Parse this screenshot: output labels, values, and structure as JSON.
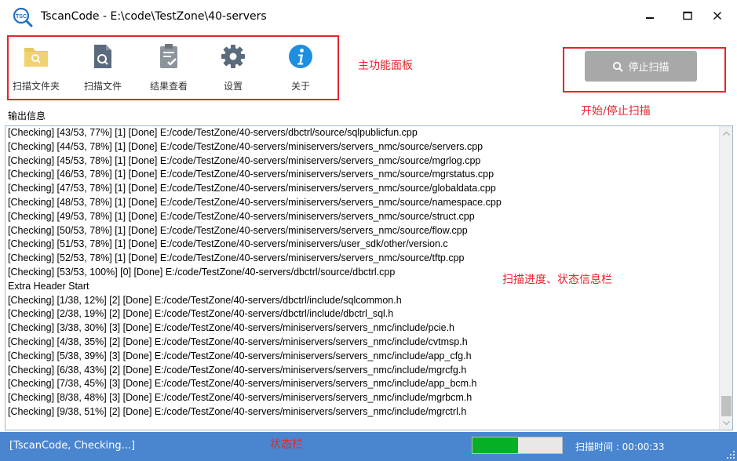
{
  "window": {
    "title": "TscanCode  -  E:\\code\\TestZone\\40-servers",
    "app_icon": "tsc-search-logo-icon",
    "controls": {
      "minimize": "minimize-icon",
      "maximize": "maximize-icon",
      "close": "close-icon"
    }
  },
  "toolbar": {
    "items": [
      {
        "label": "扫描文件夹",
        "icon": "folder-search-icon"
      },
      {
        "label": "扫描文件",
        "icon": "file-search-icon"
      },
      {
        "label": "结果查看",
        "icon": "clipboard-check-icon"
      },
      {
        "label": "设置",
        "icon": "gear-icon"
      },
      {
        "label": "关于",
        "icon": "info-icon"
      }
    ]
  },
  "scan_button": {
    "label": "停止扫描",
    "icon": "search-icon"
  },
  "annotations": {
    "main_panel": "主功能面板",
    "start_stop": "开始/停止扫描",
    "progress_info": "扫描进度、状态信息栏",
    "status_bar": "状态栏"
  },
  "output": {
    "label": "输出信息",
    "lines": [
      "[Checking] [43/53, 77%] [1] [Done] E:/code/TestZone/40-servers/dbctrl/source/sqlpublicfun.cpp",
      "[Checking] [44/53, 78%] [1] [Done] E:/code/TestZone/40-servers/miniservers/servers_nmc/source/servers.cpp",
      "[Checking] [45/53, 78%] [1] [Done] E:/code/TestZone/40-servers/miniservers/servers_nmc/source/mgrlog.cpp",
      "[Checking] [46/53, 78%] [1] [Done] E:/code/TestZone/40-servers/miniservers/servers_nmc/source/mgrstatus.cpp",
      "[Checking] [47/53, 78%] [1] [Done] E:/code/TestZone/40-servers/miniservers/servers_nmc/source/globaldata.cpp",
      "[Checking] [48/53, 78%] [1] [Done] E:/code/TestZone/40-servers/miniservers/servers_nmc/source/namespace.cpp",
      "[Checking] [49/53, 78%] [1] [Done] E:/code/TestZone/40-servers/miniservers/servers_nmc/source/struct.cpp",
      "[Checking] [50/53, 78%] [1] [Done] E:/code/TestZone/40-servers/miniservers/servers_nmc/source/flow.cpp",
      "[Checking] [51/53, 78%] [1] [Done] E:/code/TestZone/40-servers/miniservers/user_sdk/other/version.c",
      "[Checking] [52/53, 78%] [1] [Done] E:/code/TestZone/40-servers/miniservers/servers_nmc/source/tftp.cpp",
      "[Checking] [53/53, 100%] [0] [Done] E:/code/TestZone/40-servers/dbctrl/source/dbctrl.cpp",
      "Extra Header Start",
      "[Checking] [1/38, 12%] [2] [Done] E:/code/TestZone/40-servers/dbctrl/include/sqlcommon.h",
      "[Checking] [2/38, 19%] [2] [Done] E:/code/TestZone/40-servers/dbctrl/include/dbctrl_sql.h",
      "[Checking] [3/38, 30%] [3] [Done] E:/code/TestZone/40-servers/miniservers/servers_nmc/include/pcie.h",
      "[Checking] [4/38, 35%] [2] [Done] E:/code/TestZone/40-servers/miniservers/servers_nmc/include/cvtmsp.h",
      "[Checking] [5/38, 39%] [3] [Done] E:/code/TestZone/40-servers/miniservers/servers_nmc/include/app_cfg.h",
      "[Checking] [6/38, 43%] [2] [Done] E:/code/TestZone/40-servers/miniservers/servers_nmc/include/mgrcfg.h",
      "[Checking] [7/38, 45%] [3] [Done] E:/code/TestZone/40-servers/miniservers/servers_nmc/include/app_bcm.h",
      "[Checking] [8/38, 48%] [3] [Done] E:/code/TestZone/40-servers/miniservers/servers_nmc/include/mgrbcm.h",
      "[Checking] [9/38, 51%] [2] [Done] E:/code/TestZone/40-servers/miniservers/servers_nmc/include/mgrctrl.h"
    ]
  },
  "status": {
    "text": "[TscanCode, Checking...]",
    "progress_fraction": 0.51,
    "scan_time": "扫描时间 : 00:00:33"
  },
  "colors": {
    "accent_red": "#e8242e",
    "status_bar_blue": "#4a86cf",
    "progress_green": "#06b025",
    "folder_yellow": "#e9c85a",
    "icon_slate": "#5b6b7e",
    "info_blue": "#1e8ee0"
  }
}
